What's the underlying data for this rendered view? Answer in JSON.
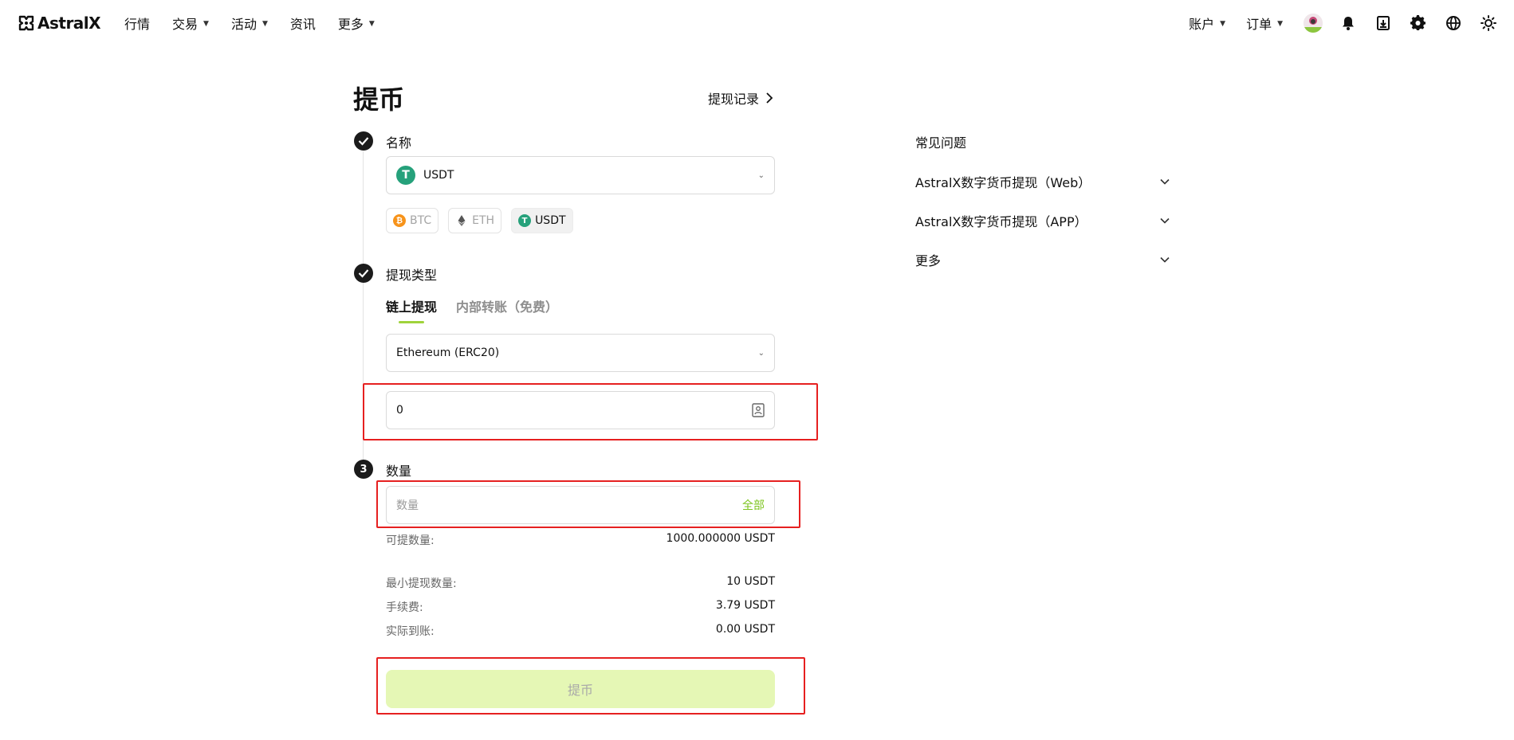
{
  "brand": {
    "name": "AstralX"
  },
  "nav": {
    "left": [
      {
        "label": "行情",
        "dropdown": false
      },
      {
        "label": "交易",
        "dropdown": true
      },
      {
        "label": "活动",
        "dropdown": true
      },
      {
        "label": "资讯",
        "dropdown": false
      },
      {
        "label": "更多",
        "dropdown": true
      }
    ],
    "right": [
      {
        "label": "账户",
        "dropdown": true
      },
      {
        "label": "订单",
        "dropdown": true
      }
    ],
    "icons": [
      "avatar",
      "bell-icon",
      "download-icon",
      "gear-icon",
      "globe-icon",
      "sun-icon"
    ]
  },
  "page": {
    "title": "提币",
    "history_link": "提现记录"
  },
  "steps": {
    "name": {
      "label": "名称",
      "selected_coin": "USDT",
      "quick_coins": [
        {
          "label": "BTC",
          "color": "#f7931a",
          "active": false
        },
        {
          "label": "ETH",
          "color": "#627eea",
          "active": false
        },
        {
          "label": "USDT",
          "color": "#26a17b",
          "active": true
        }
      ]
    },
    "type": {
      "label": "提现类型",
      "tabs": [
        {
          "label": "链上提现",
          "active": true
        },
        {
          "label": "内部转账（免费）",
          "active": false
        }
      ],
      "network": "Ethereum (ERC20)",
      "address_value": "0"
    },
    "amount": {
      "step_number": "3",
      "label": "数量",
      "placeholder": "数量",
      "all_label": "全部",
      "available_label": "可提数量:",
      "available_value": "1000.000000 USDT",
      "min_label": "最小提现数量:",
      "min_value": "10 USDT",
      "fee_label": "手续费:",
      "fee_value": "3.79 USDT",
      "receive_label": "实际到账:",
      "receive_value": "0.00 USDT"
    },
    "submit_label": "提币"
  },
  "faq": {
    "title": "常见问题",
    "items": [
      "AstralX数字货币提现（Web）",
      "AstralX数字货币提现（APP）",
      "更多"
    ]
  },
  "colors": {
    "accent": "#9fd33b",
    "accent_text": "#7cc41e",
    "submit_disabled_bg": "#e5f7b5",
    "highlight_box": "#e62020"
  }
}
